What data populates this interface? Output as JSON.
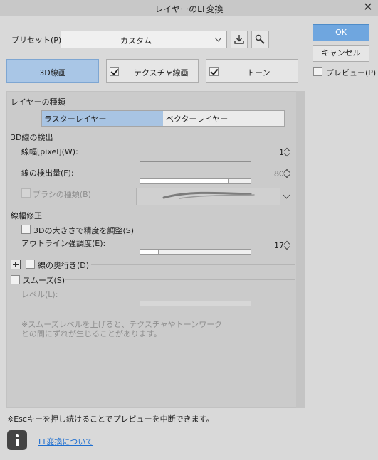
{
  "window": {
    "title": "レイヤーのLT変換",
    "close": "✕"
  },
  "preset": {
    "label": "プリセット(P):",
    "value": "カスタム"
  },
  "buttons": {
    "ok": "OK",
    "cancel": "キャンセル",
    "preview": "プレビュー(P)"
  },
  "modes": [
    {
      "label": "3D線画",
      "selected": true
    },
    {
      "label": "テクスチャ線画",
      "checked": true
    },
    {
      "label": "トーン",
      "checked": true
    }
  ],
  "layer_type": {
    "heading": "レイヤーの種類",
    "options": [
      "ラスターレイヤー",
      "ベクターレイヤー"
    ],
    "selected": "ラスターレイヤー"
  },
  "detect_3d": {
    "heading": "3D線の検出",
    "width_label": "線幅[pixel](W):",
    "width_value": "1",
    "amount_label": "線の検出量(F):",
    "amount_value": "80",
    "amount_fraction": 0.8,
    "brush_label": "ブラシの種類(B)"
  },
  "line_width_fix": {
    "heading": "線幅修正",
    "adjust_label": "3Dの大きさで精度を調整(S)",
    "outline_label": "アウトライン強調度(E):",
    "outline_value": "17",
    "outline_fraction": 0.17,
    "depth_label": "線の奥行き(D)"
  },
  "smooth": {
    "label": "スムーズ(S)",
    "level_label": "レベル(L):",
    "note": "※スムーズレベルを上げると、テクスチャやトーンワークとの間にずれが生じることがあります。"
  },
  "footer": {
    "note": "※Escキーを押し続けることでプレビューを中断できます。",
    "link": "LT変換について"
  }
}
